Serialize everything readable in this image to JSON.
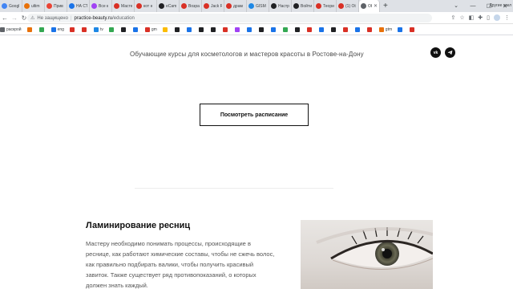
{
  "tabs": [
    {
      "label": "Googl",
      "color": "#4285f4"
    },
    {
      "label": "ultim",
      "color": "#e8710a"
    },
    {
      "label": "Прив",
      "color": "#ea4335"
    },
    {
      "label": "НА СТ",
      "color": "#1a73e8"
    },
    {
      "label": "Все к",
      "color": "#a142f4"
    },
    {
      "label": "Масте",
      "color": "#d93025"
    },
    {
      "label": "кот н",
      "color": "#d93025"
    },
    {
      "label": "eCam",
      "color": "#202124"
    },
    {
      "label": "Возра",
      "color": "#d93025"
    },
    {
      "label": "Jack R",
      "color": "#d93025"
    },
    {
      "label": "драм",
      "color": "#d93025"
    },
    {
      "label": "GISM",
      "color": "#1e88e5"
    },
    {
      "label": "Настр",
      "color": "#202124"
    },
    {
      "label": "Войти",
      "color": "#202124"
    },
    {
      "label": "Теори",
      "color": "#d93025"
    },
    {
      "label": "(1) Ot",
      "color": "#d93025"
    },
    {
      "label": "Ob",
      "color": "#5f6368",
      "active": true
    }
  ],
  "toolbar": {
    "security_label": "Не защищено",
    "url_host": "practice-beauty.ru",
    "url_path": "/education"
  },
  "bookmarks": [
    {
      "label": "раскрой",
      "color": "#5f6368"
    },
    {
      "label": "",
      "color": "#e8710a"
    },
    {
      "label": "",
      "color": "#34a853"
    },
    {
      "label": "eng",
      "color": "#1a73e8"
    },
    {
      "label": "",
      "color": "#d93025"
    },
    {
      "label": "",
      "color": "#d93025"
    },
    {
      "label": "tv",
      "color": "#1e88e5"
    },
    {
      "label": "",
      "color": "#34a853"
    },
    {
      "label": "",
      "color": "#202124"
    },
    {
      "label": "",
      "color": "#1a73e8"
    },
    {
      "label": "gm",
      "color": "#d93025"
    },
    {
      "label": "",
      "color": "#fbbc04"
    },
    {
      "label": "",
      "color": "#202124"
    },
    {
      "label": "",
      "color": "#1a73e8"
    },
    {
      "label": "",
      "color": "#202124"
    },
    {
      "label": "",
      "color": "#202124"
    },
    {
      "label": "",
      "color": "#d93025"
    },
    {
      "label": "",
      "color": "#a142f4"
    },
    {
      "label": "",
      "color": "#1a73e8"
    },
    {
      "label": "",
      "color": "#202124"
    },
    {
      "label": "",
      "color": "#1a73e8"
    },
    {
      "label": "",
      "color": "#34a853"
    },
    {
      "label": "",
      "color": "#202124"
    },
    {
      "label": "",
      "color": "#d93025"
    },
    {
      "label": "",
      "color": "#1a73e8"
    },
    {
      "label": "",
      "color": "#202124"
    },
    {
      "label": "",
      "color": "#d93025"
    },
    {
      "label": "",
      "color": "#1a73e8"
    },
    {
      "label": "",
      "color": "#d93025"
    },
    {
      "label": "gtm",
      "color": "#e8710a"
    },
    {
      "label": "",
      "color": "#1a73e8"
    },
    {
      "label": "",
      "color": "#d93025"
    }
  ],
  "bookmarks_other": "Другие закл",
  "page": {
    "subtitle": "Обучающие курсы для косметологов и мастеров красоты в Ростове-на-Дону",
    "vk_label": "vk",
    "schedule_button": "Посмотреть расписание",
    "course_title": "Ламинирование ресниц",
    "course_description": "Мастеру необходимо понимать процессы, происходящие в реснице, как работают химические составы, чтобы не сжечь волос, как правильно подбирать валики, чтобы получить красивый завиток. Также существует ряд противопоказаний, о которых должен знать каждый."
  },
  "colors": {
    "social_bg": "#111111",
    "page_bg": "#ffffff",
    "tabstrip_bg": "#dee1e6"
  }
}
